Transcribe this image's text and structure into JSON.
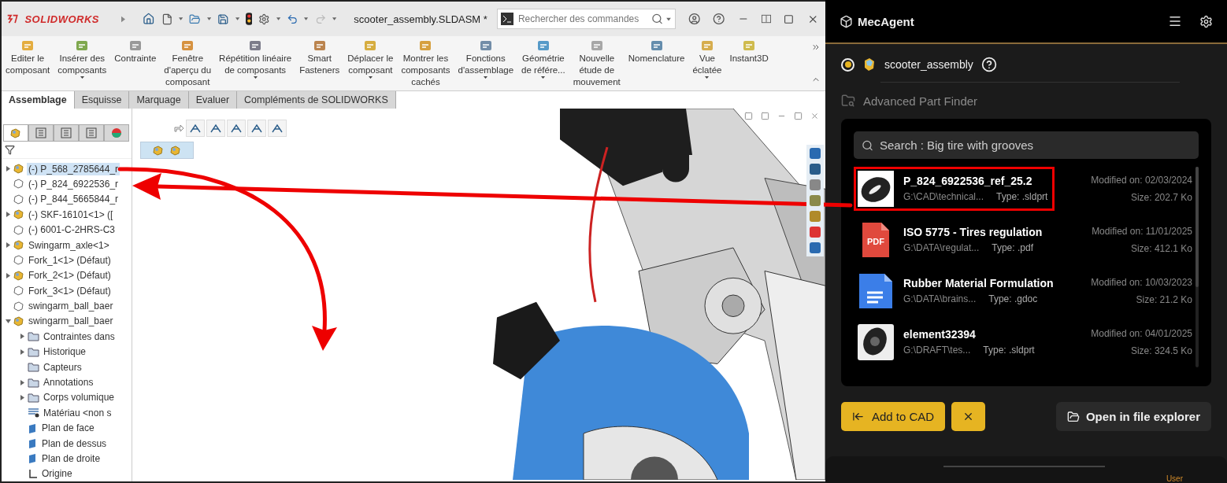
{
  "solidworks": {
    "logo": "SOLIDWORKS",
    "file_title": "scooter_assembly.SLDASM *",
    "command_search": {
      "placeholder": "Rechercher des commandes"
    },
    "ribbon": [
      {
        "label": "Editer le\ncomposant",
        "dropdown": false
      },
      {
        "label": "Insérer des\ncomposants",
        "dropdown": true
      },
      {
        "label": "Contrainte",
        "dropdown": false
      },
      {
        "label": "Fenêtre\nd'aperçu du\ncomposant",
        "dropdown": false
      },
      {
        "label": "Répétition linéaire\nde composants",
        "dropdown": true
      },
      {
        "label": "Smart\nFasteners",
        "dropdown": false
      },
      {
        "label": "Déplacer le\ncomposant",
        "dropdown": true
      },
      {
        "label": "Montrer les\ncomposants\ncachés",
        "dropdown": false
      },
      {
        "label": "Fonctions\nd'assemblage",
        "dropdown": true
      },
      {
        "label": "Géométrie\nde référe...",
        "dropdown": true
      },
      {
        "label": "Nouvelle\nétude de\nmouvement",
        "dropdown": false
      },
      {
        "label": "Nomenclature",
        "dropdown": false
      },
      {
        "label": "Vue\néclatée",
        "dropdown": true
      },
      {
        "label": "Instant3D",
        "dropdown": false
      }
    ],
    "panel_tabs": [
      {
        "selected": true
      },
      {
        "selected": false
      },
      {
        "selected": false
      },
      {
        "selected": false
      },
      {
        "selected": false
      }
    ],
    "tabs": [
      {
        "label": "Assemblage",
        "selected": true
      },
      {
        "label": "Esquisse",
        "selected": false
      },
      {
        "label": "Marquage",
        "selected": false
      },
      {
        "label": "Evaluer",
        "selected": false
      },
      {
        "label": "Compléments de SOLIDWORKS",
        "selected": false
      }
    ],
    "tree": [
      {
        "label": "(-) P_568_2785644_r",
        "kind": "assembly",
        "expanded": false,
        "selected": true
      },
      {
        "label": "(-) P_824_6922536_r",
        "kind": "part",
        "selected": false
      },
      {
        "label": "(-) P_844_5665844_r",
        "kind": "part",
        "selected": false
      },
      {
        "label": "(-) SKF-16101<1> ([",
        "kind": "assembly",
        "expanded": false,
        "selected": false
      },
      {
        "label": "(-) 6001-C-2HRS-C3",
        "kind": "part",
        "selected": false
      },
      {
        "label": "Swingarm_axle<1>",
        "kind": "assembly",
        "expanded": false,
        "selected": false
      },
      {
        "label": "Fork_1<1> (Défaut)",
        "kind": "part",
        "selected": false
      },
      {
        "label": "Fork_2<1> (Défaut)",
        "kind": "assembly",
        "expanded": false,
        "selected": false
      },
      {
        "label": "Fork_3<1> (Défaut)",
        "kind": "part",
        "selected": false
      },
      {
        "label": "swingarm_ball_baer",
        "kind": "part",
        "selected": false
      },
      {
        "label": "swingarm_ball_baer",
        "kind": "assembly",
        "expanded": true,
        "selected": false,
        "children": [
          {
            "label": "Contraintes dans",
            "kind": "folder",
            "expanded": false,
            "selected": false
          },
          {
            "label": "Historique",
            "kind": "folder",
            "expanded": false,
            "selected": false
          },
          {
            "label": "Capteurs",
            "kind": "folder",
            "selected": false
          },
          {
            "label": "Annotations",
            "kind": "folder",
            "expanded": false,
            "selected": false
          },
          {
            "label": "Corps volumique",
            "kind": "folder",
            "expanded": false,
            "selected": false
          },
          {
            "label": "Matériau <non s",
            "kind": "material",
            "selected": false
          },
          {
            "label": "Plan de face",
            "kind": "plane",
            "selected": false
          },
          {
            "label": "Plan de dessus",
            "kind": "plane",
            "selected": false
          },
          {
            "label": "Plan de droite",
            "kind": "plane",
            "selected": false
          },
          {
            "label": "Origine",
            "kind": "origin",
            "selected": false
          }
        ]
      }
    ]
  },
  "mecagent": {
    "brand": "MecAgent",
    "assembly": {
      "name": "scooter_assembly",
      "connected": true
    },
    "section_title": "Advanced Part Finder",
    "search": {
      "value": "Search : Big tire with grooves"
    },
    "results": [
      {
        "name": "P_824_6922536_ref_25.2",
        "path": "G:\\CAD\\technical...",
        "type": "Type: .sldprt",
        "modified": "Modified on: 02/03/2024",
        "size": "Size: 202.7 Ko",
        "kind": "tire",
        "highlighted": true
      },
      {
        "name": "ISO 5775 - Tires regulation",
        "path": "G:\\DATA\\regulat...",
        "type": "Type: .pdf",
        "modified": "Modified on: 11/01/2025",
        "size": "Size: 412.1 Ko",
        "kind": "pdf",
        "badge": "PDF",
        "highlighted": false
      },
      {
        "name": "Rubber Material Formulation",
        "path": "G:\\DATA\\brains...",
        "type": "Type: .gdoc",
        "modified": "Modified on: 10/03/2023",
        "size": "Size: 21.2 Ko",
        "kind": "gdoc",
        "highlighted": false
      },
      {
        "name": "element32394",
        "path": "G:\\DRAFT\\tes...",
        "type": "Type: .sldprt",
        "modified": "Modified on: 04/01/2025",
        "size": "Size: 324.5 Ko",
        "kind": "wheel",
        "highlighted": false
      }
    ],
    "buttons": {
      "add": "Add to CAD",
      "open": "Open in file explorer"
    },
    "footer_user": "User"
  }
}
